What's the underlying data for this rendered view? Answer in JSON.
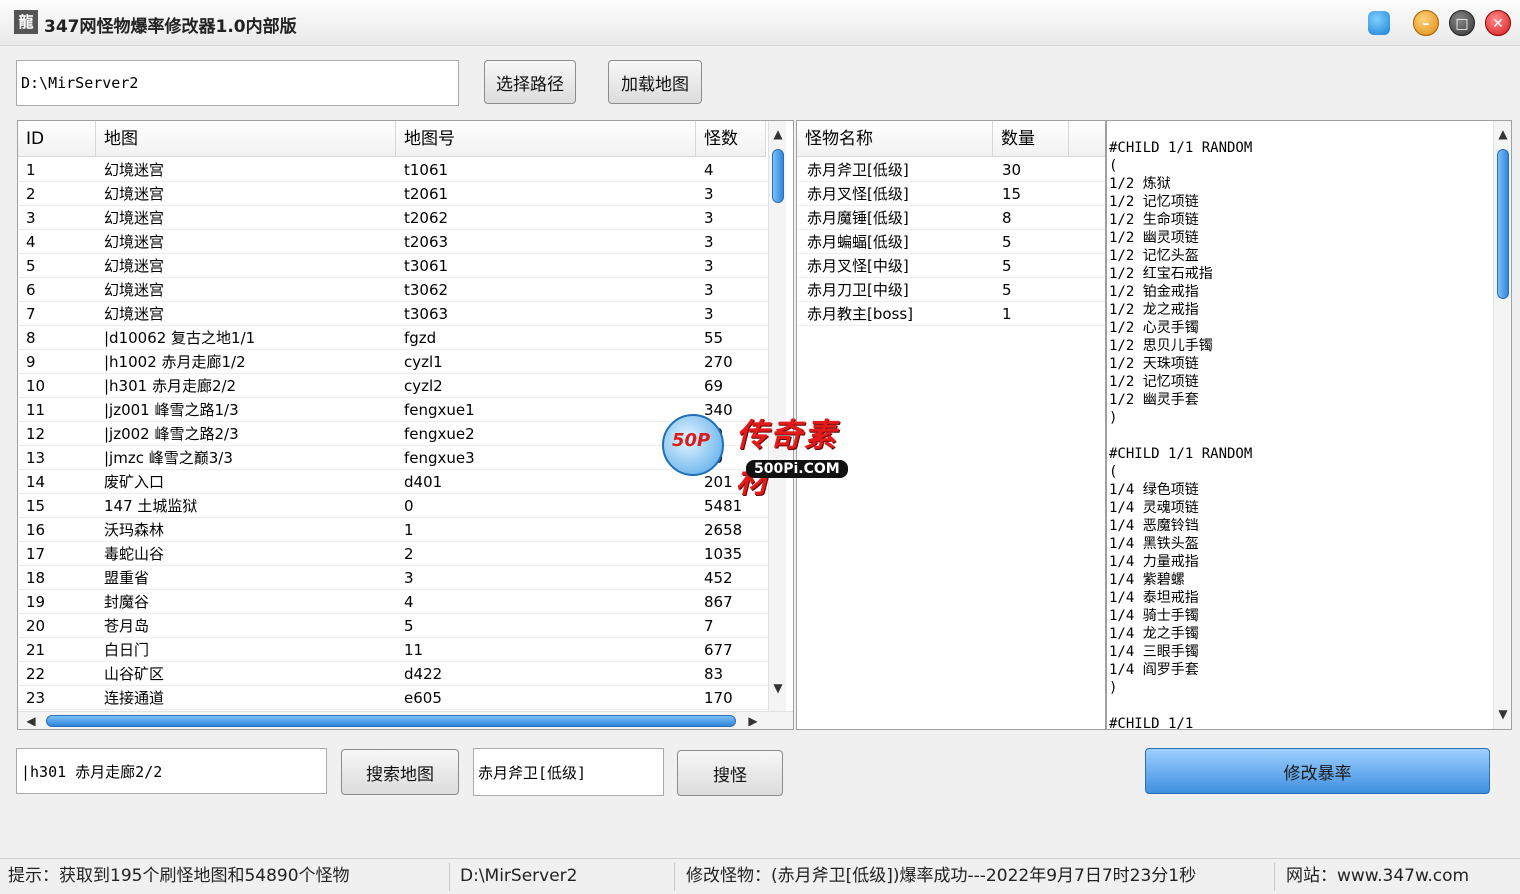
{
  "window": {
    "title": "347网怪物爆率修改器1.0内部版",
    "icon_glyph": "龍"
  },
  "top": {
    "path_value": "D:\\MirServer2",
    "select_path_label": "选择路径",
    "load_map_label": "加载地图"
  },
  "map_table": {
    "headers": [
      "ID",
      "地图",
      "地图号",
      "怪数"
    ],
    "rows": [
      [
        "1",
        " 幻境迷宫",
        "t1061",
        "4"
      ],
      [
        "2",
        " 幻境迷宫",
        "t2061",
        "3"
      ],
      [
        "3",
        " 幻境迷宫",
        "t2062",
        "3"
      ],
      [
        "4",
        " 幻境迷宫",
        "t2063",
        "3"
      ],
      [
        "5",
        " 幻境迷宫",
        "t3061",
        "3"
      ],
      [
        "6",
        " 幻境迷宫",
        "t3062",
        "3"
      ],
      [
        "7",
        " 幻境迷宫",
        "t3063",
        "3"
      ],
      [
        "8",
        "|d10062 复古之地1/1",
        "fgzd",
        "55"
      ],
      [
        "9",
        "|h1002 赤月走廊1/2",
        "cyzl1",
        "270"
      ],
      [
        "10",
        "|h301 赤月走廊2/2",
        "cyzl2",
        "69"
      ],
      [
        "11",
        "|jz001 峰雪之路1/3",
        "fengxue1",
        "340"
      ],
      [
        "12",
        "|jz002 峰雪之路2/3",
        "fengxue2",
        "50"
      ],
      [
        "13",
        "|jmzc 峰雪之巅3/3",
        "fengxue3",
        "30"
      ],
      [
        "14",
        " 废矿入口",
        "d401",
        "201"
      ],
      [
        "15",
        "147 土城监狱",
        "0",
        "5481"
      ],
      [
        "16",
        " 沃玛森林",
        "1",
        "2658"
      ],
      [
        "17",
        " 毒蛇山谷",
        "2",
        "1035"
      ],
      [
        "18",
        " 盟重省",
        "3",
        "452"
      ],
      [
        "19",
        " 封魔谷",
        "4",
        "867"
      ],
      [
        "20",
        " 苍月岛",
        "5",
        "7"
      ],
      [
        "21",
        " 白日门",
        "11",
        "677"
      ],
      [
        "22",
        " 山谷矿区",
        "d422",
        "83"
      ],
      [
        "23",
        " 连接通道",
        "e605",
        "170"
      ]
    ]
  },
  "monster_table": {
    "headers": [
      "怪物名称",
      "数量"
    ],
    "rows": [
      [
        "赤月斧卫[低级]",
        "30"
      ],
      [
        "赤月叉怪[低级]",
        "15"
      ],
      [
        "赤月魔锤[低级]",
        "8"
      ],
      [
        "赤月蝙蝠[低级]",
        "5"
      ],
      [
        "赤月叉怪[中级]",
        "5"
      ],
      [
        "赤月刀卫[中级]",
        "5"
      ],
      [
        "赤月教主[boss]",
        "1"
      ]
    ]
  },
  "drop_text": "#CHILD 1/1 RANDOM\n(\n1/2 炼狱\n1/2 记忆项链\n1/2 生命项链\n1/2 幽灵项链\n1/2 记忆头盔\n1/2 红宝石戒指\n1/2 铂金戒指\n1/2 龙之戒指\n1/2 心灵手镯\n1/2 思贝儿手镯\n1/2 天珠项链\n1/2 记忆项链\n1/2 幽灵手套\n)\n\n#CHILD 1/1 RANDOM\n(\n1/4 绿色项链\n1/4 灵魂项链\n1/4 恶魔铃铛\n1/4 黑铁头盔\n1/4 力量戒指\n1/4 紫碧螺\n1/4 泰坦戒指\n1/4 骑士手镯\n1/4 龙之手镯\n1/4 三眼手镯\n1/4 阎罗手套\n)\n\n#CHILD 1/1",
  "bottom": {
    "map_search_value": "|h301 赤月走廊2/2",
    "search_map_label": "搜索地图",
    "monster_search_value": "赤月斧卫[低级]",
    "search_monster_label": "搜怪",
    "modify_rate_label": "修改暴率"
  },
  "status": {
    "hint": "提示：获取到195个刷怪地图和54890个怪物",
    "path": "D:\\MirServer2",
    "result": "修改怪物：(赤月斧卫[低级])爆率成功---2022年9月7日7时23分1秒",
    "site": "网站：www.347w.com"
  },
  "watermark": {
    "logo_text": "50P",
    "title": "传奇素材",
    "sub": "500Pi.COM"
  },
  "colors": {
    "accent": "#2f86d9",
    "primary_button": "#3f8fe0",
    "watermark_red": "#e21a1a"
  }
}
